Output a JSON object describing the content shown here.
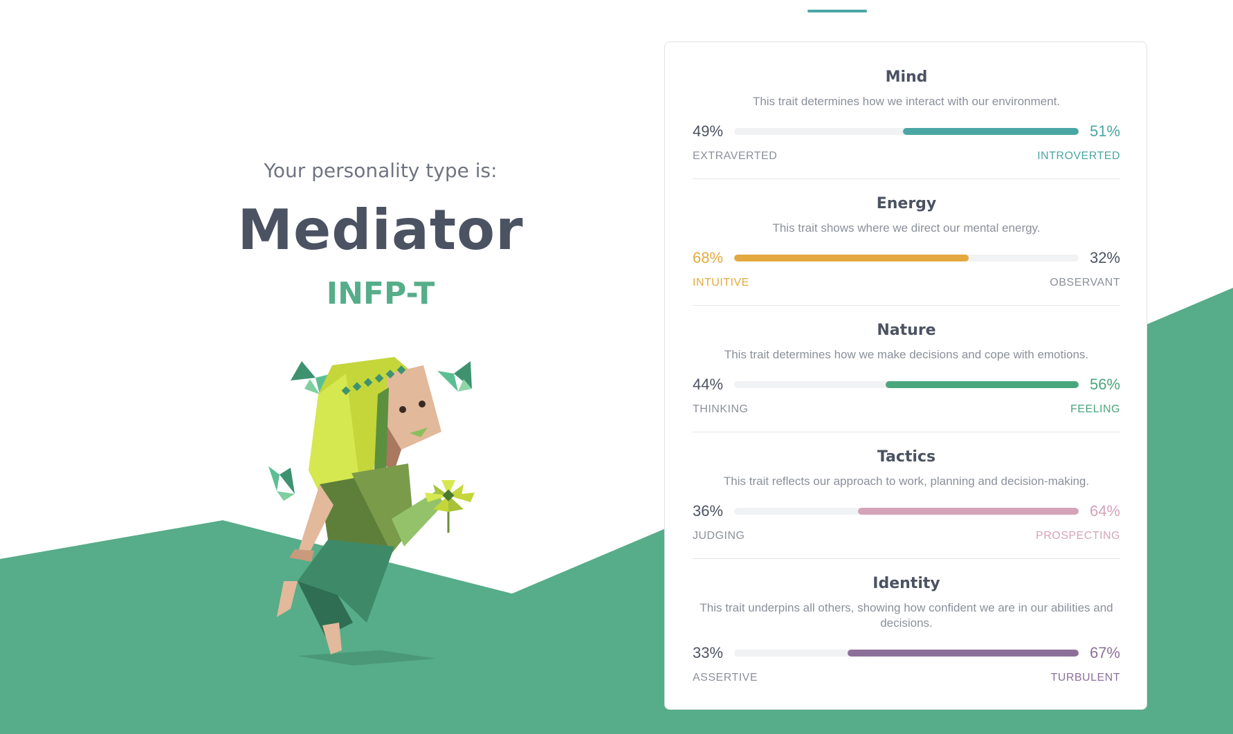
{
  "hero": {
    "subtitle": "Your personality type is:",
    "type_name": "Mediator",
    "type_code": "INFP-T"
  },
  "colors": {
    "background_green": "#57ac89",
    "mind": "#4aa6a3",
    "energy": "#e3a93f",
    "nature": "#4aa67d",
    "tactics": "#d4a3b8",
    "identity": "#8d7099",
    "neutral_text": "#4b5262",
    "muted_text": "#8a909a"
  },
  "traits": [
    {
      "title": "Mind",
      "description": "This trait determines how we interact with our environment.",
      "left_percent": "49%",
      "right_percent": "51%",
      "left_label": "EXTRAVERTED",
      "right_label": "INTROVERTED",
      "dominant": "right",
      "dominant_fraction": 0.51,
      "color": "#4aa6a3"
    },
    {
      "title": "Energy",
      "description": "This trait shows where we direct our mental energy.",
      "left_percent": "68%",
      "right_percent": "32%",
      "left_label": "INTUITIVE",
      "right_label": "OBSERVANT",
      "dominant": "left",
      "dominant_fraction": 0.68,
      "color": "#e3a93f"
    },
    {
      "title": "Nature",
      "description": "This trait determines how we make decisions and cope with emotions.",
      "left_percent": "44%",
      "right_percent": "56%",
      "left_label": "THINKING",
      "right_label": "FEELING",
      "dominant": "right",
      "dominant_fraction": 0.56,
      "color": "#4aa67d"
    },
    {
      "title": "Tactics",
      "description": "This trait reflects our approach to work, planning and decision-making.",
      "left_percent": "36%",
      "right_percent": "64%",
      "left_label": "JUDGING",
      "right_label": "PROSPECTING",
      "dominant": "right",
      "dominant_fraction": 0.64,
      "color": "#d4a3b8"
    },
    {
      "title": "Identity",
      "description": "This trait underpins all others, showing how confident we are in our abilities and decisions.",
      "left_percent": "33%",
      "right_percent": "67%",
      "left_label": "ASSERTIVE",
      "right_label": "TURBULENT",
      "dominant": "right",
      "dominant_fraction": 0.67,
      "color": "#8d7099"
    }
  ]
}
